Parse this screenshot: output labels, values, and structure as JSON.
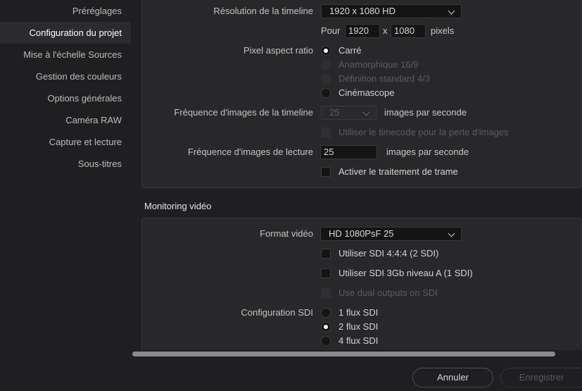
{
  "sidebar": {
    "items": [
      {
        "label": "Préréglages",
        "active": false
      },
      {
        "label": "Configuration du projet",
        "active": true
      },
      {
        "label": "Mise à l'échelle Sources",
        "active": false
      },
      {
        "label": "Gestion des couleurs",
        "active": false
      },
      {
        "label": "Options générales",
        "active": false
      },
      {
        "label": "Caméra RAW",
        "active": false
      },
      {
        "label": "Capture et lecture",
        "active": false
      },
      {
        "label": "Sous-titres",
        "active": false
      }
    ]
  },
  "timeline": {
    "resolution_label": "Résolution de la timeline",
    "resolution_value": "1920 x 1080 HD",
    "for_label": "Pour",
    "width": "1920",
    "x_label": "x",
    "height": "1080",
    "pixels_label": "pixels",
    "par_label": "Pixel aspect ratio",
    "par_options": [
      {
        "label": "Carré",
        "selected": true,
        "disabled": false
      },
      {
        "label": "Anamorphique 16/9",
        "selected": false,
        "disabled": true
      },
      {
        "label": "Définition standard 4/3",
        "selected": false,
        "disabled": true
      },
      {
        "label": "Cinémascope",
        "selected": false,
        "disabled": false
      }
    ],
    "fps_label": "Fréquence d'images de la timeline",
    "fps_value": "25",
    "fps_unit": "images par seconde",
    "drop_frame_label": "Utiliser le timecode pour la perte d'images",
    "playback_fps_label": "Fréquence d'images de lecture",
    "playback_fps_value": "25",
    "playback_fps_unit": "images par seconde",
    "interlace_label": "Activer le traitement de trame"
  },
  "monitoring": {
    "section_title": "Monitoring vidéo",
    "format_label": "Format vidéo",
    "format_value": "HD 1080PsF 25",
    "sdi444_label": "Utiliser SDI 4:4:4 (2 SDI)",
    "sdi3g_label": "Utiliser SDI 3Gb niveau A (1 SDI)",
    "dual_label": "Use dual outputs on SDI",
    "sdi_config_label": "Configuration SDI",
    "sdi_options": [
      {
        "label": "1 flux SDI",
        "selected": false
      },
      {
        "label": "2 flux SDI",
        "selected": true
      },
      {
        "label": "4 flux SDI",
        "selected": false
      }
    ]
  },
  "footer": {
    "cancel_label": "Annuler",
    "save_label": "Enregistrer"
  }
}
